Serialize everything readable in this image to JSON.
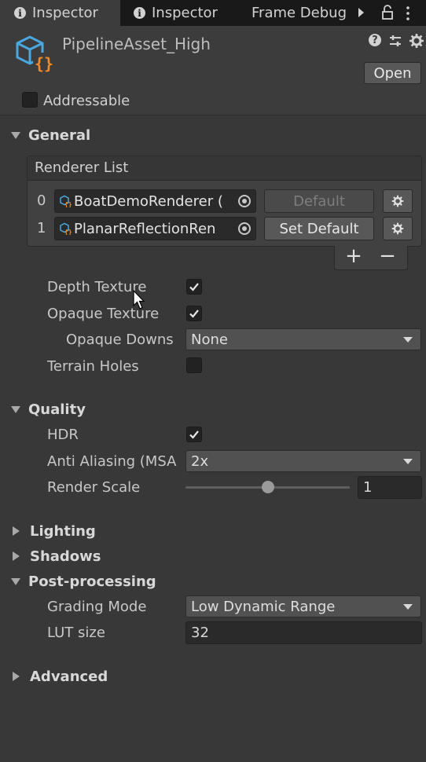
{
  "tabs": [
    {
      "label": "Inspector",
      "active": true
    },
    {
      "label": "Inspector",
      "active": false
    },
    {
      "label": "Frame Debug",
      "active": false
    }
  ],
  "asset": {
    "name": "PipelineAsset_High",
    "open_label": "Open"
  },
  "addressable": {
    "label": "Addressable",
    "checked": false
  },
  "sections": {
    "general": "General",
    "quality": "Quality",
    "lighting": "Lighting",
    "shadows": "Shadows",
    "post_processing": "Post-processing",
    "advanced": "Advanced"
  },
  "renderer_list": {
    "title": "Renderer List",
    "items": [
      {
        "index": "0",
        "name": "BoatDemoRenderer (",
        "button": "Default",
        "button_enabled": false
      },
      {
        "index": "1",
        "name": "PlanarReflectionRen",
        "button": "Set Default",
        "button_enabled": true
      }
    ],
    "add_label": "+",
    "remove_label": "−"
  },
  "general": {
    "depth_texture": {
      "label": "Depth Texture",
      "checked": true
    },
    "opaque_texture": {
      "label": "Opaque Texture",
      "checked": true
    },
    "opaque_downsampling": {
      "label": "Opaque Downs",
      "value": "None"
    },
    "terrain_holes": {
      "label": "Terrain Holes",
      "checked": false
    }
  },
  "quality": {
    "hdr": {
      "label": "HDR",
      "checked": true
    },
    "anti_aliasing": {
      "label": "Anti Aliasing (MSA",
      "value": "2x"
    },
    "render_scale": {
      "label": "Render Scale",
      "value": "1",
      "slider_fraction": 0.5
    }
  },
  "post_processing": {
    "grading_mode": {
      "label": "Grading Mode",
      "value": "Low Dynamic Range"
    },
    "lut_size": {
      "label": "LUT size",
      "value": "32"
    }
  },
  "colors": {
    "background": "#383838",
    "tabbar": "#191919",
    "accent_orange": "#f0892a",
    "accent_blue": "#4aa8e0"
  }
}
